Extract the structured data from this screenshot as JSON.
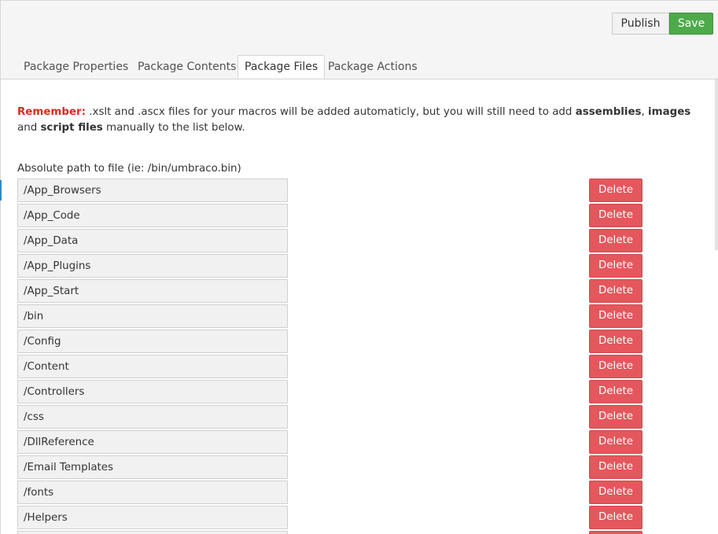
{
  "toolbar": {
    "publish_label": "Publish",
    "save_label": "Save",
    "save_color": "#4ea94b"
  },
  "tabs": [
    {
      "label": "Package Properties",
      "active": false
    },
    {
      "label": "Package Contents",
      "active": false
    },
    {
      "label": "Package Files",
      "active": true
    },
    {
      "label": "Package Actions",
      "active": false
    }
  ],
  "notice": {
    "remember": "Remember:",
    "text1": " .xslt and .ascx files for your macros will be added automaticly, but you will still need to add ",
    "bold1": "assemblies",
    "sep1": ", ",
    "bold2": "images",
    "text2": " and ",
    "bold3": "script files",
    "text3": " manually to the list below.",
    "remember_color": "#e0291d"
  },
  "files": {
    "label": "Absolute path to file (ie: /bin/umbraco.bin)",
    "delete_label": "Delete",
    "delete_color": "#e4575c",
    "items": [
      "/App_Browsers",
      "/App_Code",
      "/App_Data",
      "/App_Plugins",
      "/App_Start",
      "/bin",
      "/Config",
      "/Content",
      "/Controllers",
      "/css",
      "/DllReference",
      "/Email Templates",
      "/fonts",
      "/Helpers",
      ""
    ]
  }
}
